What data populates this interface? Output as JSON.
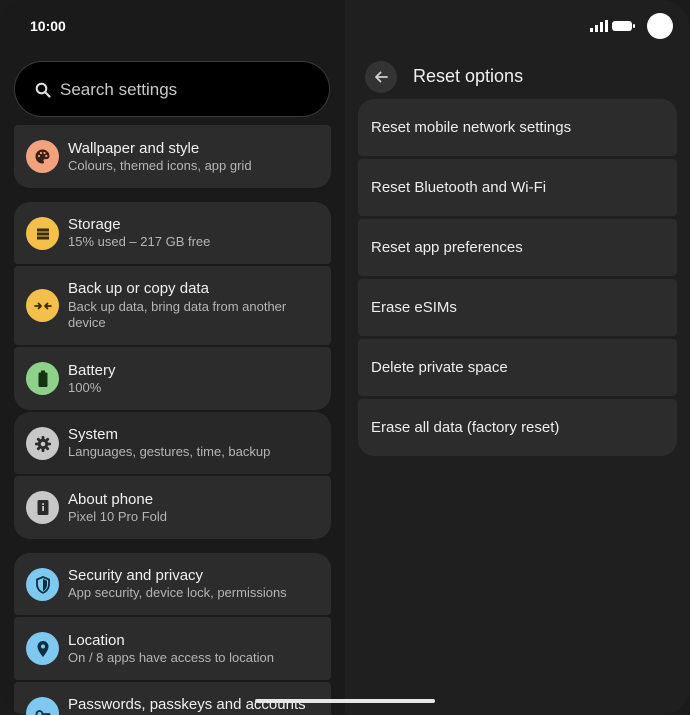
{
  "status": {
    "time": "10:00"
  },
  "search": {
    "placeholder": "Search settings"
  },
  "settings": [
    {
      "title": "Wallpaper and style",
      "subtitle": "Colours, themed icons, app grid",
      "icon": "palette-icon",
      "color": "#f2a27e"
    },
    {
      "title": "Storage",
      "subtitle": "15% used – 217 GB free",
      "icon": "storage-icon",
      "color": "#f3c14b"
    },
    {
      "title": "Back up or copy data",
      "subtitle": "Back up data, bring data from another device",
      "icon": "backup-arrows-icon",
      "color": "#f3c14b"
    },
    {
      "title": "Battery",
      "subtitle": "100%",
      "icon": "battery-icon",
      "color": "#8fd18a"
    },
    {
      "title": "System",
      "subtitle": "Languages, gestures, time, backup",
      "icon": "gear-icon",
      "color": "#c8c8c8"
    },
    {
      "title": "About phone",
      "subtitle": "Pixel 10 Pro Fold",
      "icon": "info-icon",
      "color": "#c8c8c8"
    },
    {
      "title": "Security and privacy",
      "subtitle": "App security, device lock, permissions",
      "icon": "shield-icon",
      "color": "#7fc8f0"
    },
    {
      "title": "Location",
      "subtitle": "On / 8 apps have access to location",
      "icon": "location-pin-icon",
      "color": "#7fc8f0"
    },
    {
      "title": "Passwords, passkeys and accounts",
      "subtitle": "",
      "icon": "key-icon",
      "color": "#7fc8f0"
    }
  ],
  "reset": {
    "title": "Reset options",
    "options": [
      "Reset mobile network settings",
      "Reset Bluetooth and Wi-Fi",
      "Reset app preferences",
      "Erase eSIMs",
      "Delete private space",
      "Erase all data (factory reset)"
    ]
  }
}
